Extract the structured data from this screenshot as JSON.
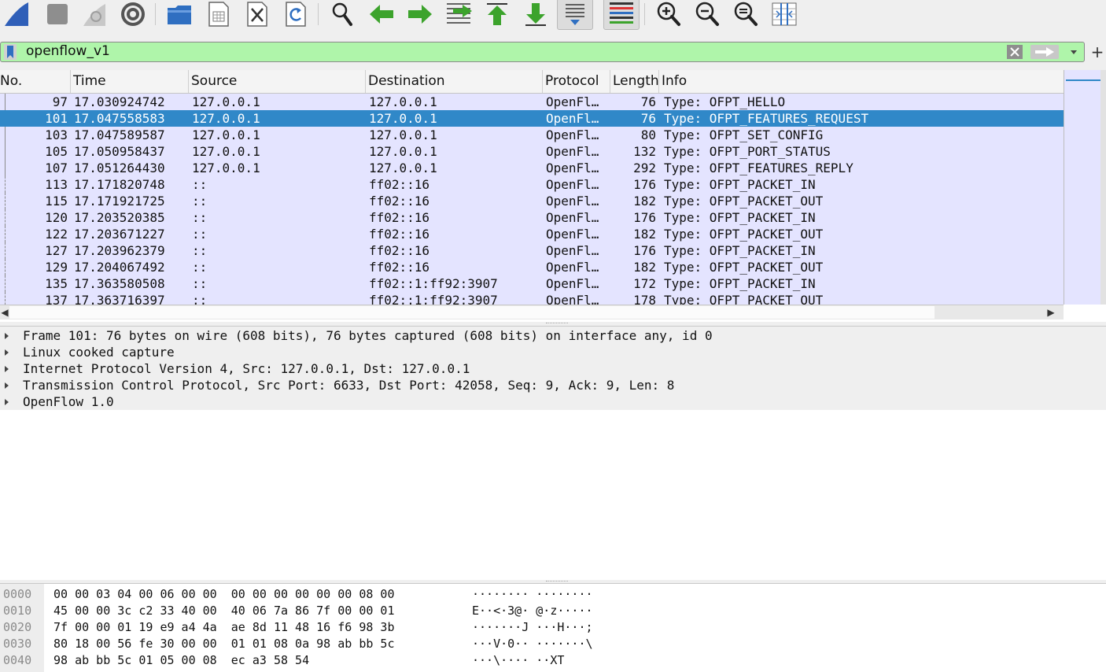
{
  "filter": {
    "text": "openflow_v1"
  },
  "columns": [
    "No.",
    "Time",
    "Source",
    "Destination",
    "Protocol",
    "Length",
    "Info"
  ],
  "packets": [
    {
      "no": "97",
      "time": "17.030924742",
      "src": "127.0.0.1",
      "dst": "127.0.0.1",
      "proto": "OpenFl…",
      "len": "76",
      "info": "Type: OFPT_HELLO"
    },
    {
      "no": "101",
      "time": "17.047558583",
      "src": "127.0.0.1",
      "dst": "127.0.0.1",
      "proto": "OpenFl…",
      "len": "76",
      "info": "Type: OFPT_FEATURES_REQUEST",
      "selected": true
    },
    {
      "no": "103",
      "time": "17.047589587",
      "src": "127.0.0.1",
      "dst": "127.0.0.1",
      "proto": "OpenFl…",
      "len": "80",
      "info": "Type: OFPT_SET_CONFIG"
    },
    {
      "no": "105",
      "time": "17.050958437",
      "src": "127.0.0.1",
      "dst": "127.0.0.1",
      "proto": "OpenFl…",
      "len": "132",
      "info": "Type: OFPT_PORT_STATUS"
    },
    {
      "no": "107",
      "time": "17.051264430",
      "src": "127.0.0.1",
      "dst": "127.0.0.1",
      "proto": "OpenFl…",
      "len": "292",
      "info": "Type: OFPT_FEATURES_REPLY"
    },
    {
      "no": "113",
      "time": "17.171820748",
      "src": "::",
      "dst": "ff02::16",
      "proto": "OpenFl…",
      "len": "176",
      "info": "Type: OFPT_PACKET_IN"
    },
    {
      "no": "115",
      "time": "17.171921725",
      "src": "::",
      "dst": "ff02::16",
      "proto": "OpenFl…",
      "len": "182",
      "info": "Type: OFPT_PACKET_OUT"
    },
    {
      "no": "120",
      "time": "17.203520385",
      "src": "::",
      "dst": "ff02::16",
      "proto": "OpenFl…",
      "len": "176",
      "info": "Type: OFPT_PACKET_IN"
    },
    {
      "no": "122",
      "time": "17.203671227",
      "src": "::",
      "dst": "ff02::16",
      "proto": "OpenFl…",
      "len": "182",
      "info": "Type: OFPT_PACKET_OUT"
    },
    {
      "no": "127",
      "time": "17.203962379",
      "src": "::",
      "dst": "ff02::16",
      "proto": "OpenFl…",
      "len": "176",
      "info": "Type: OFPT_PACKET_IN"
    },
    {
      "no": "129",
      "time": "17.204067492",
      "src": "::",
      "dst": "ff02::16",
      "proto": "OpenFl…",
      "len": "182",
      "info": "Type: OFPT_PACKET_OUT"
    },
    {
      "no": "135",
      "time": "17.363580508",
      "src": "::",
      "dst": "ff02::1:ff92:3907",
      "proto": "OpenFl…",
      "len": "172",
      "info": "Type: OFPT_PACKET_IN"
    },
    {
      "no": "137",
      "time": "17.363716397",
      "src": "::",
      "dst": "ff02::1:ff92:3907",
      "proto": "OpenFl…",
      "len": "178",
      "info": "Type: OFPT_PACKET_OUT"
    }
  ],
  "details": [
    "Frame 101: 76 bytes on wire (608 bits), 76 bytes captured (608 bits) on interface any, id 0",
    "Linux cooked capture",
    "Internet Protocol Version 4, Src: 127.0.0.1, Dst: 127.0.0.1",
    "Transmission Control Protocol, Src Port: 6633, Dst Port: 42058, Seq: 9, Ack: 9, Len: 8",
    "OpenFlow 1.0"
  ],
  "bytes": [
    {
      "offset": "0000",
      "hex": "00 00 03 04 00 06 00 00  00 00 00 00 00 00 08 00",
      "ascii": "········ ········"
    },
    {
      "offset": "0010",
      "hex": "45 00 00 3c c2 33 40 00  40 06 7a 86 7f 00 00 01",
      "ascii": "E··<·3@· @·z·····"
    },
    {
      "offset": "0020",
      "hex": "7f 00 00 01 19 e9 a4 4a  ae 8d 11 48 16 f6 98 3b",
      "ascii": "·······J ···H···;"
    },
    {
      "offset": "0030",
      "hex": "80 18 00 56 fe 30 00 00  01 01 08 0a 98 ab bb 5c",
      "ascii": "···V·0·· ·······\\"
    },
    {
      "offset": "0040",
      "hex": "98 ab bb 5c 01 05 00 08  ec a3 58 54",
      "ascii": "···\\···· ··XT"
    }
  ],
  "toolbar_icons": [
    "shark-fin-start-icon",
    "stop-icon",
    "restart-icon",
    "capture-options-icon",
    "open-folder-icon",
    "save-file-icon",
    "close-file-icon",
    "reload-icon",
    "find-icon",
    "go-back-icon",
    "go-forward-icon",
    "go-to-packet-icon",
    "first-packet-icon",
    "last-packet-icon",
    "autoscroll-icon",
    "colorize-icon",
    "zoom-in-icon",
    "zoom-out-icon",
    "zoom-normal-icon",
    "resize-columns-icon"
  ],
  "colors": {
    "filter_ok": "#aff5aa",
    "row_bg": "#e4e4ff",
    "selected": "#3088c8",
    "accent_blue": "#2f6fc1",
    "accent_green": "#3ca32c"
  }
}
